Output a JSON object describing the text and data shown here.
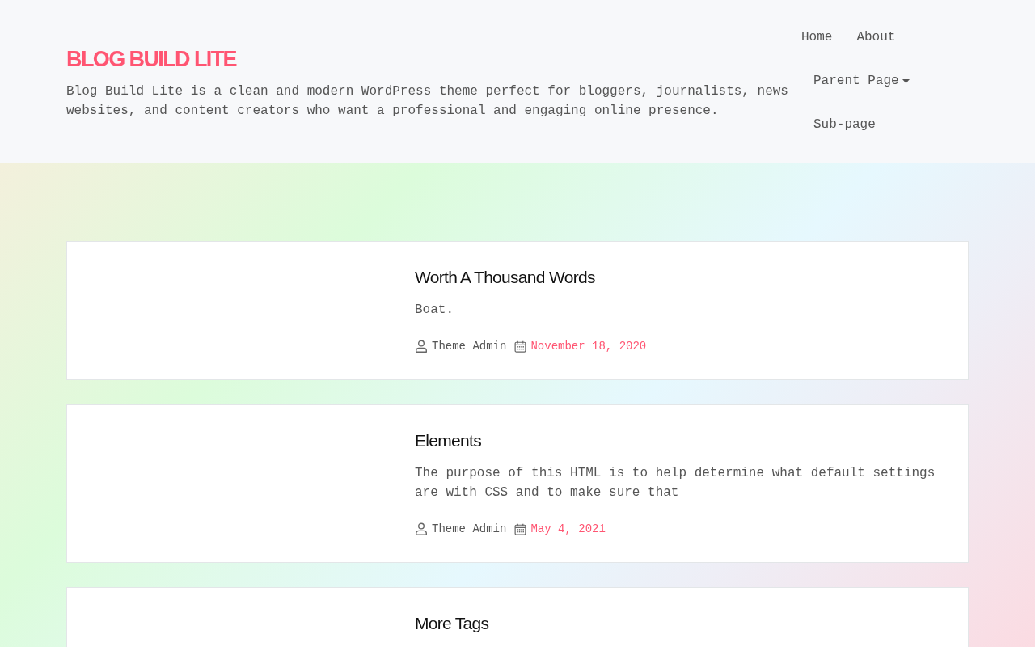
{
  "site": {
    "title": "BLOG BUILD LITE",
    "description": "Blog Build Lite is a clean and modern WordPress theme perfect for bloggers, journalists, news websites, and content creators who want a professional and engaging online presence."
  },
  "nav": [
    {
      "label": "Home"
    },
    {
      "label": "About"
    },
    {
      "label": "Parent Page",
      "children": [
        {
          "label": "Sub-page"
        }
      ]
    }
  ],
  "posts": [
    {
      "title": "Worth A Thousand Words",
      "excerpt": "Boat.",
      "author": "Theme Admin",
      "date": "November 18, 2020"
    },
    {
      "title": "Elements",
      "excerpt": "The purpose of this HTML is to help determine what default settings are with CSS and to make sure that",
      "author": "Theme Admin",
      "date": "May 4, 2021"
    },
    {
      "title": "More Tags"
    }
  ]
}
